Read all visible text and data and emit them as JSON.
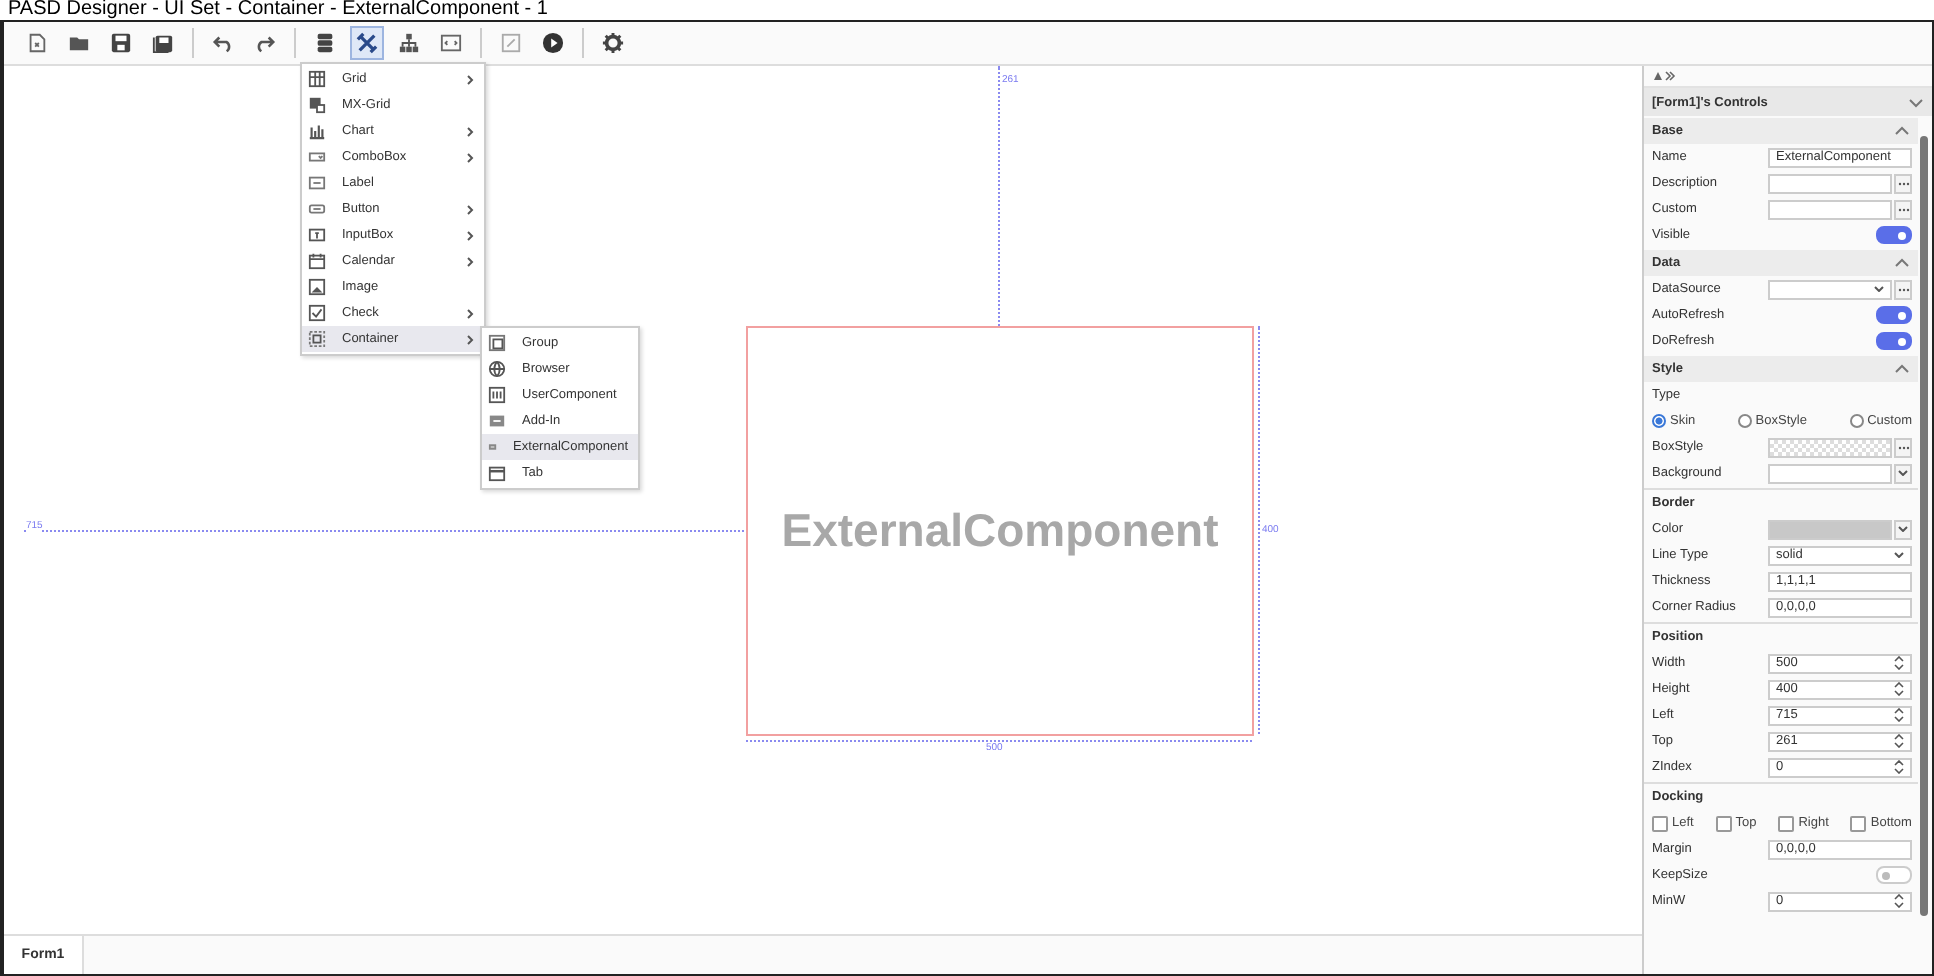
{
  "title": "PASD Designer - UI Set - Container - ExternalComponent - 1",
  "toolbar": [
    [
      {
        "kind": "new",
        "selected": false
      },
      {
        "kind": "open",
        "selected": false
      },
      {
        "kind": "save",
        "selected": false
      },
      {
        "kind": "save-all",
        "selected": false
      }
    ],
    [
      {
        "kind": "undo",
        "selected": false
      },
      {
        "kind": "redo",
        "selected": false
      }
    ],
    [
      {
        "kind": "database",
        "selected": false
      },
      {
        "kind": "tools",
        "selected": true
      },
      {
        "kind": "tree",
        "selected": false
      },
      {
        "kind": "code",
        "selected": false
      }
    ],
    [
      {
        "kind": "edit",
        "selected": false
      },
      {
        "kind": "run",
        "selected": false
      }
    ],
    [
      {
        "kind": "settings",
        "selected": false
      }
    ]
  ],
  "menu": {
    "items": [
      {
        "kind": "grid",
        "label": "Grid",
        "submenu": true,
        "selected": false
      },
      {
        "kind": "mxgrid",
        "label": "MX-Grid",
        "submenu": false,
        "selected": false
      },
      {
        "kind": "chart",
        "label": "Chart",
        "submenu": true,
        "selected": false
      },
      {
        "kind": "combo",
        "label": "ComboBox",
        "submenu": true,
        "selected": false
      },
      {
        "kind": "label",
        "label": "Label",
        "submenu": false,
        "selected": false
      },
      {
        "kind": "button",
        "label": "Button",
        "submenu": true,
        "selected": false
      },
      {
        "kind": "input",
        "label": "InputBox",
        "submenu": true,
        "selected": false
      },
      {
        "kind": "calendar",
        "label": "Calendar",
        "submenu": true,
        "selected": false
      },
      {
        "kind": "image",
        "label": "Image",
        "submenu": false,
        "selected": false
      },
      {
        "kind": "check",
        "label": "Check",
        "submenu": true,
        "selected": false
      },
      {
        "kind": "container",
        "label": "Container",
        "submenu": true,
        "selected": true
      }
    ]
  },
  "submenu": {
    "items": [
      {
        "kind": "group",
        "label": "Group",
        "selected": false
      },
      {
        "kind": "globe",
        "label": "Browser",
        "selected": false
      },
      {
        "kind": "user",
        "label": "UserComponent",
        "selected": false
      },
      {
        "kind": "addin",
        "label": "Add-In",
        "selected": false
      },
      {
        "kind": "addin",
        "label": "ExternalComponent",
        "selected": true
      },
      {
        "kind": "tab",
        "label": "Tab",
        "selected": false
      }
    ]
  },
  "canvas": {
    "component_label": "ExternalComponent",
    "top_guide": "261",
    "left_guide": "715",
    "height_guide": "400",
    "width_guide": "500"
  },
  "form_tabs": [
    {
      "label": "Form1",
      "selected": true
    }
  ],
  "panel": {
    "title": "[Form1]'s Controls",
    "sections": [
      {
        "title": "Base",
        "expanded": true,
        "rows": [
          {
            "kind": "text",
            "label": "Name",
            "value": "ExternalComponent"
          },
          {
            "kind": "text_more",
            "label": "Description"
          },
          {
            "kind": "text_more",
            "label": "Custom"
          },
          {
            "kind": "toggle",
            "label": "Visible",
            "on": true
          }
        ]
      },
      {
        "title": "Data",
        "expanded": true,
        "rows": [
          {
            "kind": "select_more",
            "label": "DataSource"
          },
          {
            "kind": "toggle",
            "label": "AutoRefresh",
            "on": true
          },
          {
            "kind": "toggle",
            "label": "DoRefresh",
            "on": true
          }
        ]
      },
      {
        "title": "Style",
        "expanded": true,
        "rows": [
          {
            "kind": "heading",
            "label": "Type"
          },
          {
            "kind": "radios",
            "options": [
              {
                "label": "Skin",
                "selected": true
              },
              {
                "label": "BoxStyle",
                "selected": false
              },
              {
                "label": "Custom",
                "selected": false
              }
            ]
          },
          {
            "kind": "pattern_more",
            "label": "BoxStyle"
          },
          {
            "kind": "select_box",
            "label": "Background"
          }
        ]
      },
      {
        "title": "Border",
        "rows": [
          {
            "kind": "color_select",
            "label": "Color"
          },
          {
            "kind": "select",
            "label": "Line Type",
            "value": "solid"
          },
          {
            "kind": "text",
            "label": "Thickness",
            "value": "1,1,1,1"
          },
          {
            "kind": "text",
            "label": "Corner Radius",
            "value": "0,0,0,0"
          }
        ]
      },
      {
        "title": "Position",
        "rows": [
          {
            "kind": "spinner",
            "label": "Width",
            "value": "500"
          },
          {
            "kind": "spinner",
            "label": "Height",
            "value": "400"
          },
          {
            "kind": "spinner",
            "label": "Left",
            "value": "715"
          },
          {
            "kind": "spinner",
            "label": "Top",
            "value": "261"
          },
          {
            "kind": "spinner",
            "label": "ZIndex",
            "value": "0"
          }
        ]
      },
      {
        "title": "Docking",
        "rows": [
          {
            "kind": "checks",
            "options": [
              {
                "label": "Left",
                "checked": false
              },
              {
                "label": "Top",
                "checked": false
              },
              {
                "label": "Right",
                "checked": false
              },
              {
                "label": "Bottom",
                "checked": false
              }
            ]
          },
          {
            "kind": "text",
            "label": "Margin",
            "value": "0,0,0,0"
          },
          {
            "kind": "toggle",
            "label": "KeepSize",
            "on": false
          },
          {
            "kind": "spinner",
            "label": "MinW",
            "value": "0"
          }
        ]
      }
    ]
  }
}
